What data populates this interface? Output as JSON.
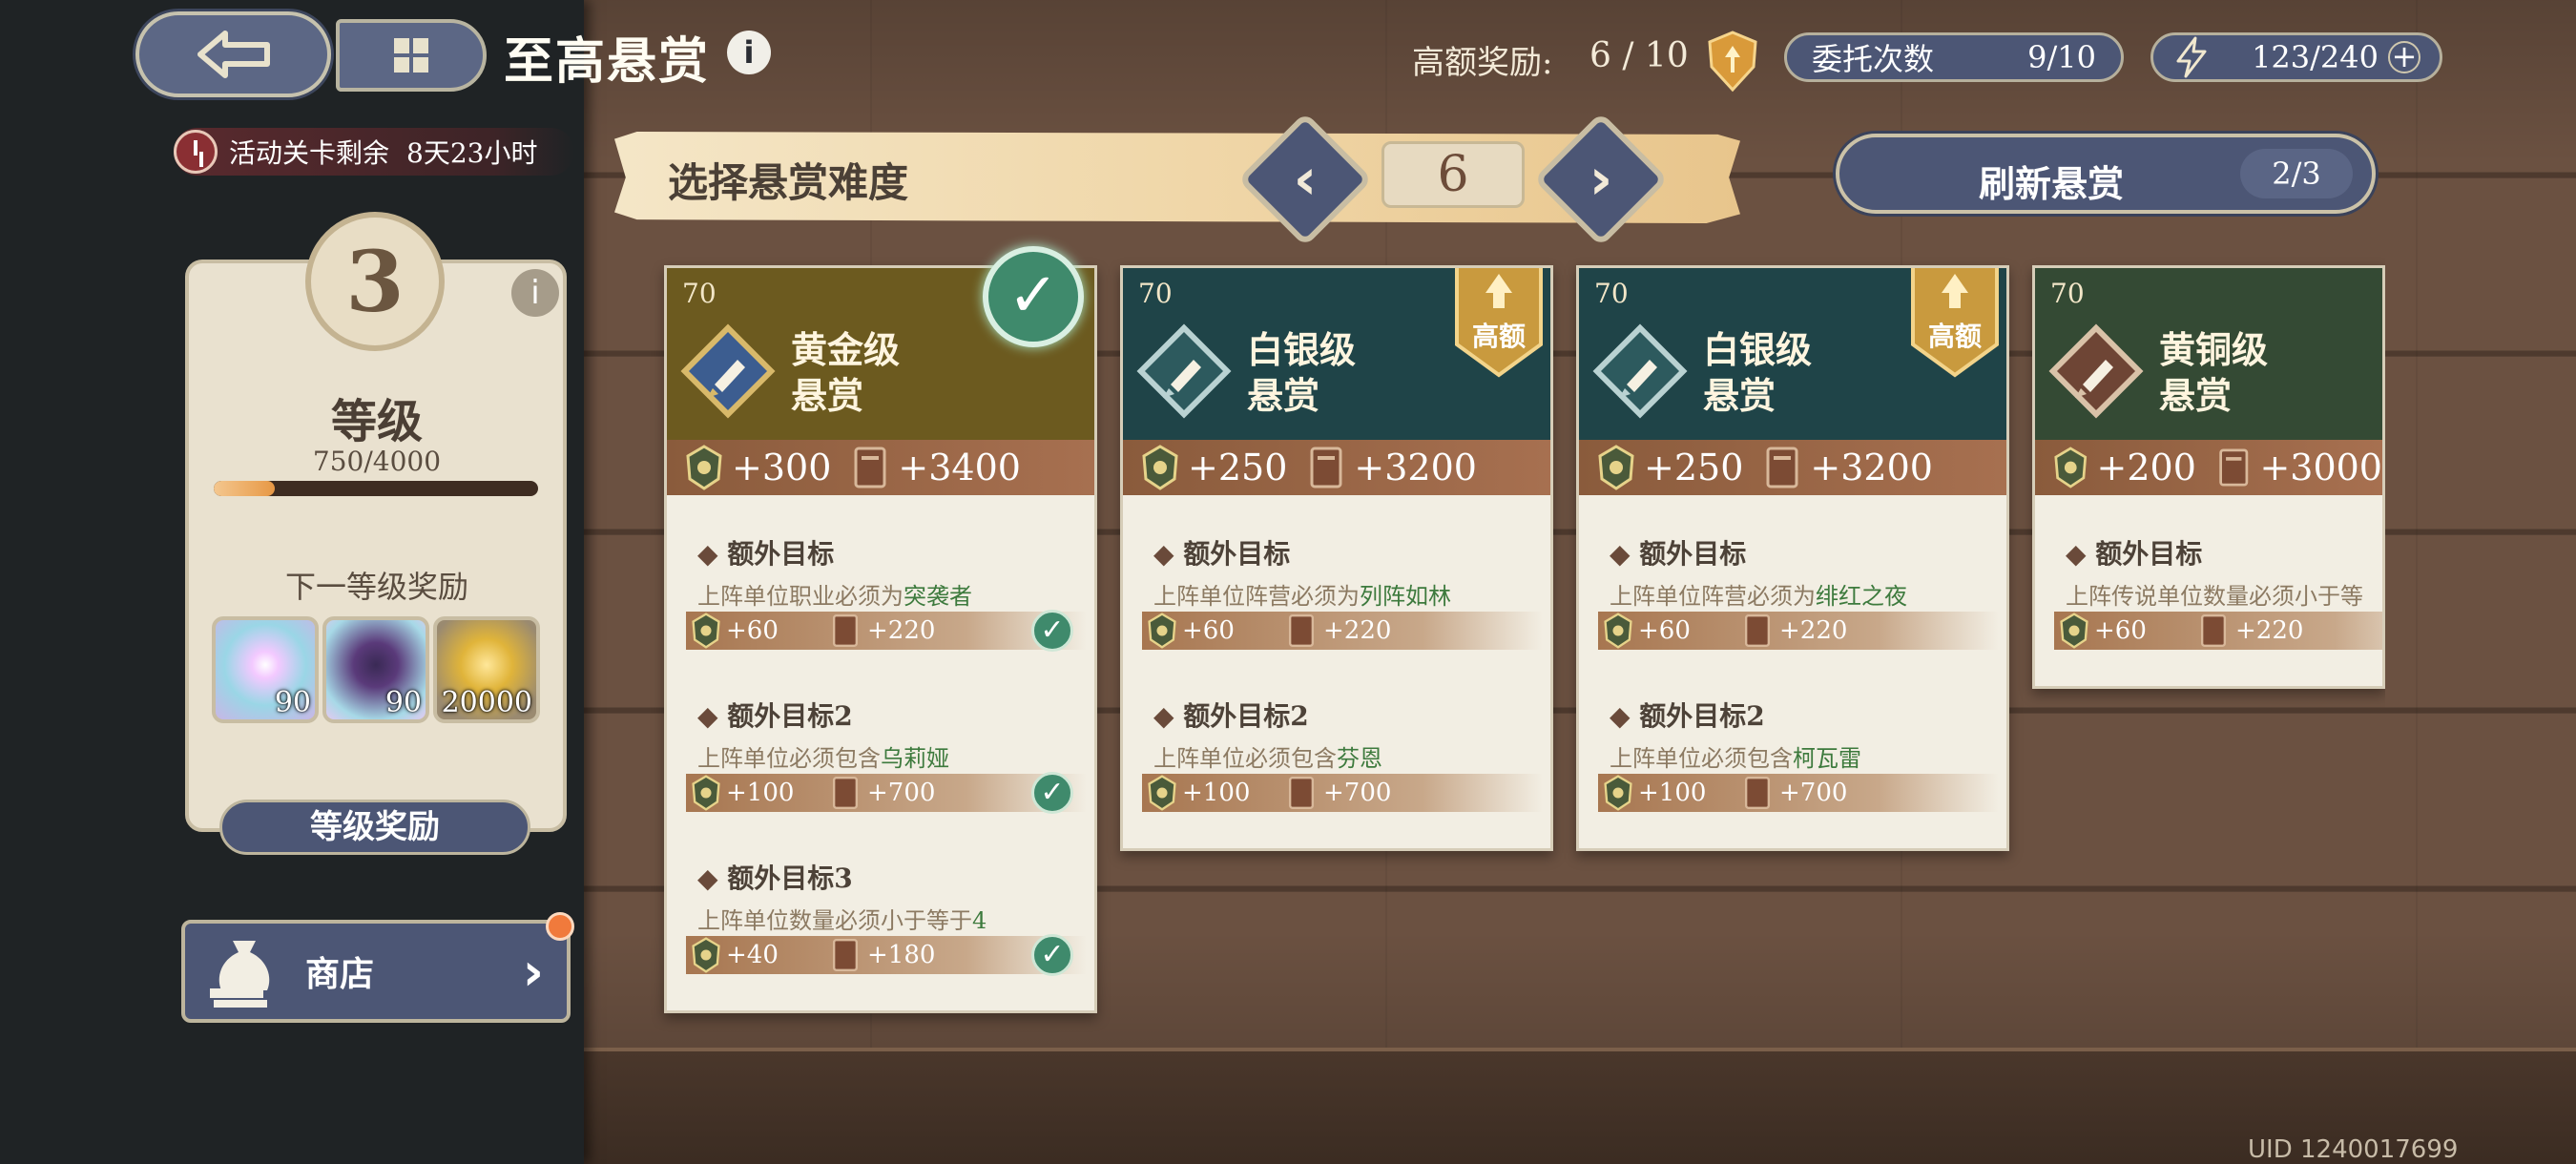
{
  "header": {
    "title": "至高悬赏",
    "title_info": "i"
  },
  "timer": {
    "label": "活动关卡剩余",
    "value": "8天23小时"
  },
  "top_stats": {
    "high_value_label": "高额奖励:",
    "high_value_count": "6 / 10",
    "commission_label": "委托次数",
    "commission_count": "9/10",
    "energy": "123/240",
    "energy_plus": "+"
  },
  "level": {
    "value": "3",
    "info": "i",
    "label": "等级",
    "progress_text": "750/4000",
    "progress": 0.1875,
    "next_reward_label": "下一等级奖励",
    "rewards": [
      "90",
      "90",
      "20000"
    ],
    "button": "等级奖励"
  },
  "shop": {
    "label": "商店",
    "arrow": "›"
  },
  "difficulty": {
    "label": "选择悬赏难度",
    "value": "6",
    "prev": "‹",
    "next": "›"
  },
  "refresh": {
    "label": "刷新悬赏",
    "count": "2/3"
  },
  "cards": [
    {
      "level": "70",
      "name1": "黄金级",
      "name2": "悬赏",
      "reward_a": "+300",
      "reward_b": "+3400",
      "badge": "",
      "goals": [
        {
          "title": "额外目标",
          "desc_pre": "上阵单位职业必须为",
          "desc_hl": "突袭者",
          "ra": "+60",
          "rb": "+220",
          "done": "✓"
        },
        {
          "title": "额外目标2",
          "desc_pre": "上阵单位必须包含",
          "desc_hl": "乌莉娅",
          "ra": "+100",
          "rb": "+700",
          "done": "✓"
        },
        {
          "title": "额外目标3",
          "desc_pre": "上阵单位数量必须小于等于",
          "desc_hl": "4",
          "ra": "+40",
          "rb": "+180",
          "done": "✓"
        }
      ]
    },
    {
      "level": "70",
      "name1": "白银级",
      "name2": "悬赏",
      "reward_a": "+250",
      "reward_b": "+3200",
      "badge": "高额",
      "goals": [
        {
          "title": "额外目标",
          "desc_pre": "上阵单位阵营必须为",
          "desc_hl": "列阵如林",
          "ra": "+60",
          "rb": "+220"
        },
        {
          "title": "额外目标2",
          "desc_pre": "上阵单位必须包含",
          "desc_hl": "芬恩",
          "ra": "+100",
          "rb": "+700"
        }
      ]
    },
    {
      "level": "70",
      "name1": "白银级",
      "name2": "悬赏",
      "reward_a": "+250",
      "reward_b": "+3200",
      "badge": "高额",
      "goals": [
        {
          "title": "额外目标",
          "desc_pre": "上阵单位阵营必须为",
          "desc_hl": "绯红之夜",
          "ra": "+60",
          "rb": "+220"
        },
        {
          "title": "额外目标2",
          "desc_pre": "上阵单位必须包含",
          "desc_hl": "柯瓦雷",
          "ra": "+100",
          "rb": "+700"
        }
      ]
    },
    {
      "level": "70",
      "name1": "黄铜级",
      "name2": "悬赏",
      "reward_a": "+200",
      "reward_b": "+3000",
      "badge": "",
      "goals": [
        {
          "title": "额外目标",
          "desc_pre": "上阵传说单位数量必须小于等",
          "desc_hl": "",
          "ra": "+60",
          "rb": "+220"
        }
      ]
    }
  ],
  "uid": "UID 1240017699",
  "colors": {
    "gold_head": "#6c5a1f",
    "silver_head": "#1f4448",
    "bronze_head": "#344a34",
    "button": "#4c5675",
    "highlight_text": "#3d7a3d"
  },
  "icons": [
    "back-icon",
    "grid-icon",
    "info-icon",
    "clock-icon",
    "medal-icon",
    "lightning-icon",
    "money-bag-icon",
    "chevron-left-icon",
    "chevron-right-icon",
    "check-icon",
    "emblem-icon",
    "book-icon"
  ]
}
